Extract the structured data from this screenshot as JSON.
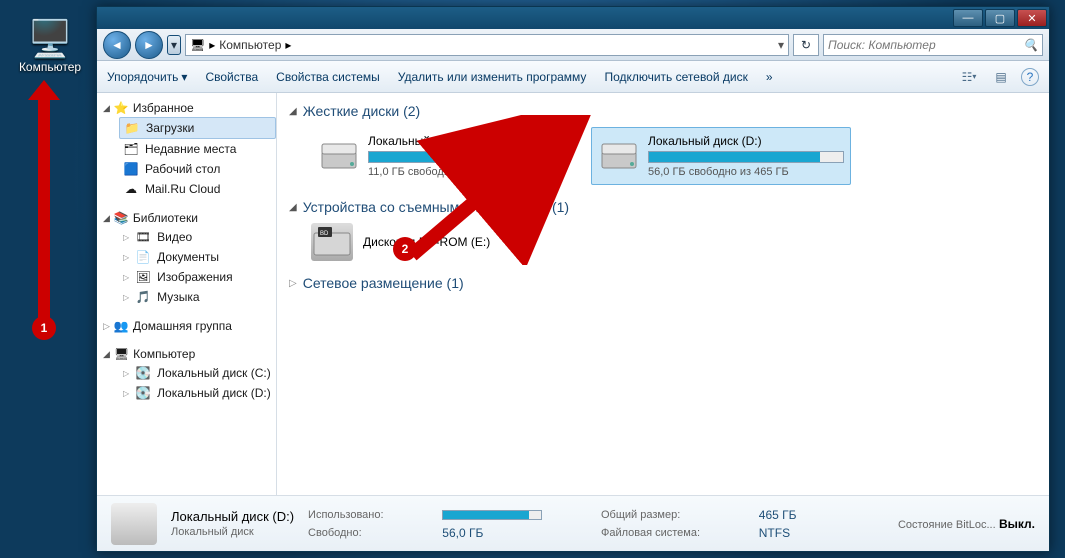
{
  "desktop_icon": {
    "label": "Компьютер"
  },
  "annotations": {
    "marker1": "1",
    "marker2": "2"
  },
  "window_controls": {
    "min": "—",
    "max": "▢",
    "close": "✕"
  },
  "address": {
    "crumb1": "Компьютер",
    "chevron": "▸"
  },
  "search": {
    "placeholder": "Поиск: Компьютер"
  },
  "cmdbar": {
    "organize": "Упорядочить",
    "properties": "Свойства",
    "system_props": "Свойства системы",
    "uninstall": "Удалить или изменить программу",
    "map_drive": "Подключить сетевой диск",
    "overflow": "»"
  },
  "nav": {
    "fav_hdr": "Избранное",
    "fav": {
      "downloads": "Загрузки",
      "recent": "Недавние места",
      "desktop": "Рабочий стол",
      "mailru": "Mail.Ru Cloud"
    },
    "lib_hdr": "Библиотеки",
    "lib": {
      "video": "Видео",
      "docs": "Документы",
      "pics": "Изображения",
      "music": "Музыка"
    },
    "home_hdr": "Домашняя группа",
    "comp_hdr": "Компьютер",
    "comp": {
      "c": "Локальный диск (C:)",
      "d": "Локальный диск (D:)"
    }
  },
  "content": {
    "hdd_hdr": "Жесткие диски (2)",
    "drives": [
      {
        "name": "Локальный диск (C:)",
        "free": "11,0 ГБ свободно из 55,7 ГБ",
        "fill_pct": 80,
        "fill_color": "#19a6d1"
      },
      {
        "name": "Локальный диск (D:)",
        "free": "56,0 ГБ свободно из 465 ГБ",
        "fill_pct": 88,
        "fill_color": "#19a6d1"
      }
    ],
    "removable_hdr": "Устройства со съемными носителями (1)",
    "removable_name": "Дисковод BD-ROM (E:)",
    "net_hdr": "Сетевое размещение (1)"
  },
  "details": {
    "title": "Локальный диск (D:)",
    "subtitle": "Локальный диск",
    "used_lbl": "Использовано:",
    "free_lbl": "Свободно:",
    "free_val": "56,0 ГБ",
    "total_lbl": "Общий размер:",
    "total_val": "465 ГБ",
    "fs_lbl": "Файловая система:",
    "fs_val": "NTFS",
    "bitlocker_lbl": "Состояние BitLoc...",
    "bitlocker_val": "Выкл."
  }
}
